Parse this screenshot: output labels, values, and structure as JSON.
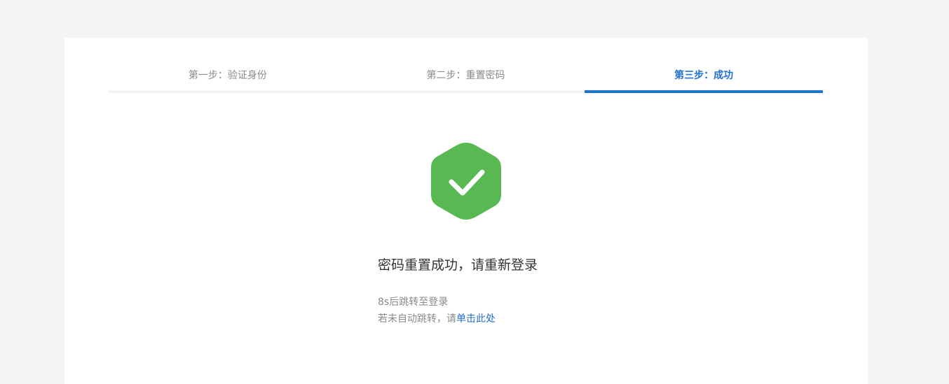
{
  "steps": [
    {
      "label": "第一步：验证身份",
      "active": false
    },
    {
      "label": "第二步：重置密码",
      "active": false
    },
    {
      "label": "第三步：成功",
      "active": true
    }
  ],
  "result": {
    "icon": "success-check-icon",
    "message": "密码重置成功，请重新登录",
    "countdown_text": "8s后跳转至登录",
    "fallback_prefix": "若未自动跳转，请",
    "fallback_link": "单击此处"
  },
  "colors": {
    "accent": "#1874d6",
    "success": "#58b852",
    "background": "#f5f5f5"
  }
}
